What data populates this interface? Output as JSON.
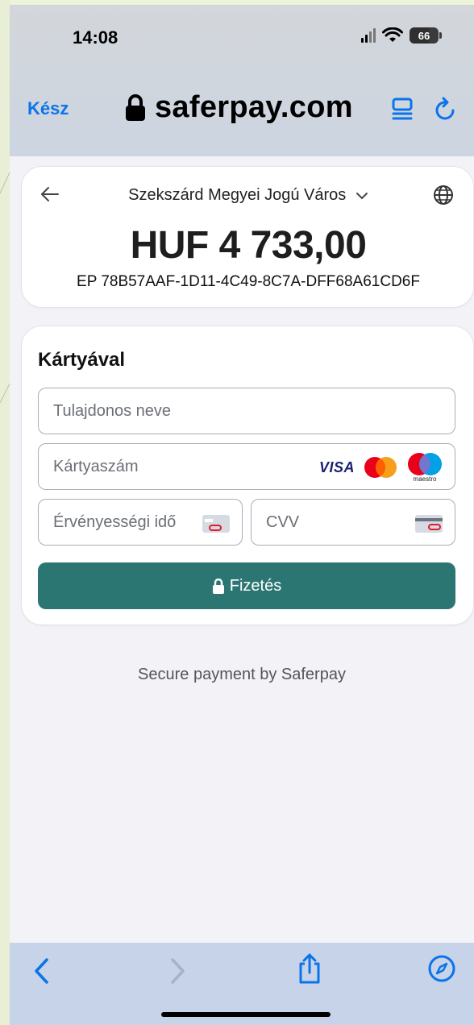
{
  "status_bar": {
    "time": "14:08",
    "battery": "66"
  },
  "browser": {
    "done_label": "Kész",
    "url": "saferpay.com"
  },
  "payment_header": {
    "merchant": "Szekszárd Megyei Jogú Város",
    "amount": "HUF 4 733,00",
    "reference": "EP 78B57AAF-1D11-4C49-8C7A-DFF68A61CD6F"
  },
  "card_form": {
    "title": "Kártyával",
    "holder_placeholder": "Tulajdonos neve",
    "number_placeholder": "Kártyaszám",
    "expiry_placeholder": "Érvényességi idő",
    "cvv_placeholder": "CVV",
    "brands": {
      "visa": "VISA",
      "maestro": "maestro"
    },
    "pay_label": "Fizetés"
  },
  "footer": {
    "secure_text": "Secure payment by Saferpay"
  },
  "colors": {
    "accent": "#0a74e8",
    "pay_button": "#2b7673",
    "background": "#f2f2f7"
  },
  "icons": [
    "lock-icon",
    "reader-icon",
    "reload-icon",
    "back-arrow-icon",
    "chevron-down-icon",
    "globe-icon",
    "visa-logo",
    "mastercard-logo",
    "maestro-logo",
    "card-icon",
    "share-icon",
    "compass-icon"
  ]
}
